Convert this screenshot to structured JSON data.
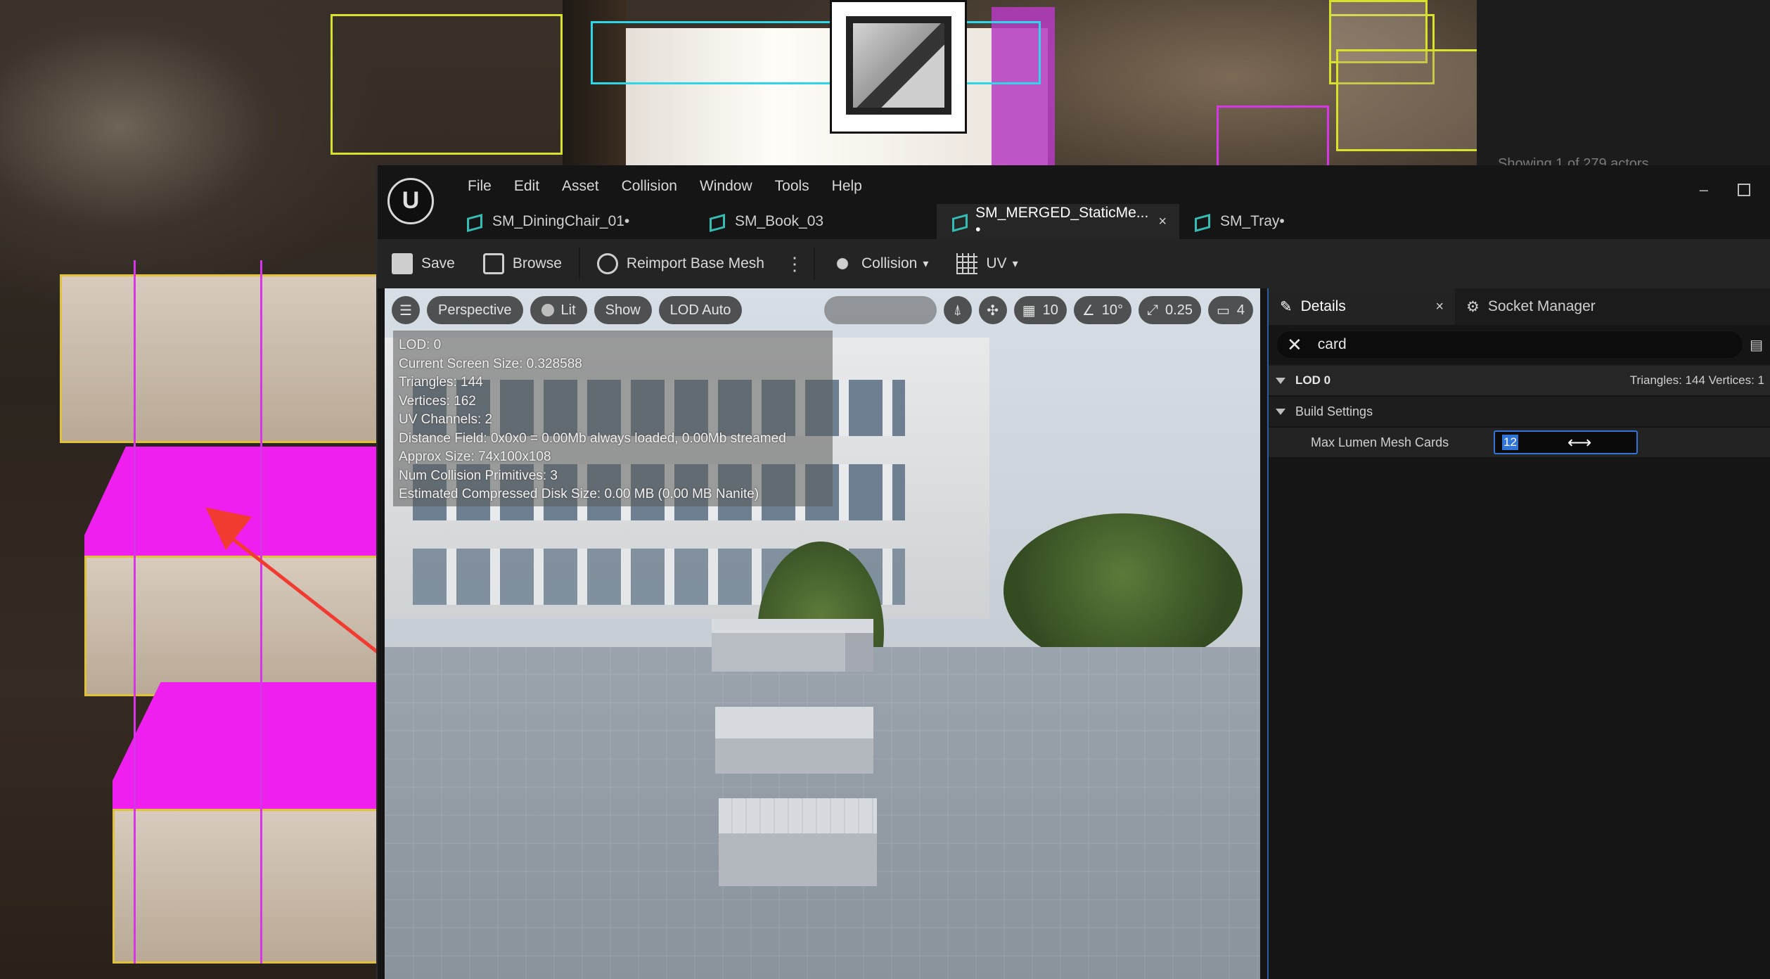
{
  "background": {
    "outliner_status": "Showing 1 of 279 actors"
  },
  "editor": {
    "logo": "U",
    "menu": [
      "File",
      "Edit",
      "Asset",
      "Collision",
      "Window",
      "Tools",
      "Help"
    ],
    "tabs": [
      {
        "label": "SM_DiningChair_01•",
        "active": false
      },
      {
        "label": "SM_Book_03",
        "active": false
      },
      {
        "label": "SM_MERGED_StaticMe... •",
        "active": true,
        "close": "×"
      },
      {
        "label": "SM_Tray•",
        "active": false
      }
    ],
    "window_controls": {
      "minimize": "–",
      "maximize": ""
    },
    "toolbar": {
      "save": "Save",
      "browse": "Browse",
      "reimport": "Reimport Base Mesh",
      "more": "⋮",
      "collision": "Collision",
      "uv": "UV"
    }
  },
  "viewport": {
    "toolbar": {
      "menu_icon": "☰",
      "perspective": "Perspective",
      "lit": "Lit",
      "show": "Show",
      "lod": "LOD Auto",
      "grid_snap": "10",
      "rot_snap": "10°",
      "scale_snap": "0.25",
      "camera_speed": "4"
    },
    "stats": [
      "LOD:  0",
      "Current Screen Size:  0.328588",
      "Triangles:  144",
      "Vertices:  162",
      "UV Channels:  2",
      "Distance Field:  0x0x0 = 0.00Mb always loaded, 0.00Mb streamed",
      "Approx Size: 74x100x108",
      "Num Collision Primitives:  3",
      "Estimated Compressed Disk Size: 0.00 MB (0.00 MB Nanite)"
    ]
  },
  "details": {
    "tab_details": "Details",
    "tab_close": "×",
    "tab_socket": "Socket Manager",
    "search_value": "card",
    "search_clear": "✕",
    "lod_label": "LOD 0",
    "lod_meta": "Triangles: 144   Vertices: 1",
    "build_settings": "Build Settings",
    "property_name": "Max Lumen Mesh Cards",
    "property_value": "12",
    "cursor": "⟷"
  },
  "colors": {
    "accent_blue": "#2f74d6",
    "arrow_red": "#f23b30",
    "tab_icon": "#34bdb4",
    "magenta": "#ef1ff0"
  }
}
